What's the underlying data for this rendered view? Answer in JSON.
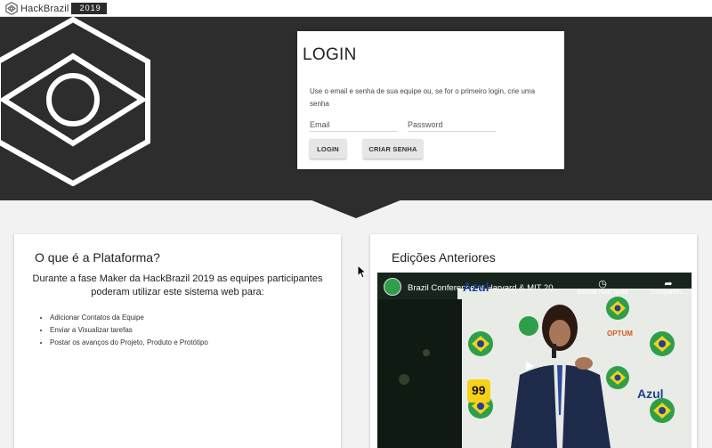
{
  "brand": {
    "name": "HackBrazil",
    "year": "2019"
  },
  "login": {
    "title": "LOGIN",
    "description": "Use o email e senha de sua equipe ou, se for o primeiro login, crie uma senha",
    "email_placeholder": "Email",
    "password_placeholder": "Password",
    "login_button": "LOGIN",
    "create_password_button": "CRIAR SENHA"
  },
  "platform": {
    "title": "O que é a Plataforma?",
    "text": "Durante a fase Maker da HackBrazil 2019 as equipes participantes poderam utilizar este sistema web para:",
    "items": [
      "Adicionar Contatos da Equipe",
      "Enviar a Visualizar tarefas",
      "Postar os avanços do Projeto, Produto e Protótipo"
    ]
  },
  "editions": {
    "title": "Edições Anteriores",
    "video": {
      "title": "Brazil Conference at Harvard & MIT 20...",
      "watch_later": "Assistir mais tarde",
      "share": "Compartilh...",
      "sign_azul": "Azul",
      "sign_99": "99",
      "sign_optum": "OPTUM"
    }
  },
  "colors": {
    "hero_bg": "#2d2d2d",
    "page_bg": "#f2f2f2",
    "button_bg": "#e6e6e6"
  }
}
